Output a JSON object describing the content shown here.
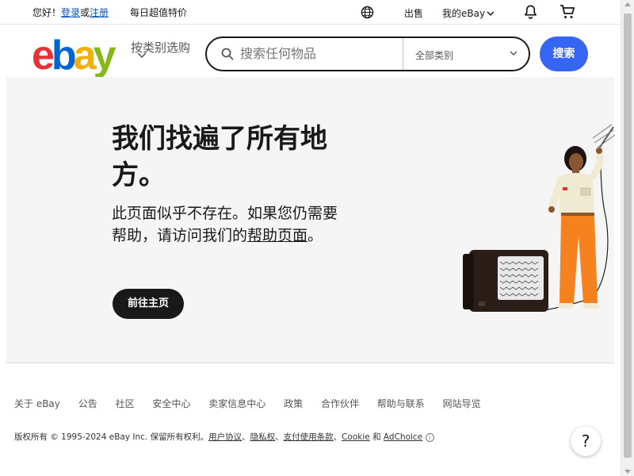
{
  "topbar": {
    "greeting": "您好！",
    "login": "登录",
    "or": "或",
    "register": "注册",
    "daily_deals": "每日超值特价",
    "sell": "出售",
    "my_ebay": "我的eBay"
  },
  "header": {
    "logo": {
      "e": "e",
      "b": "b",
      "a": "a",
      "y": "y"
    },
    "shop_by_category": "按类别选购",
    "search_placeholder": "搜索任何物品",
    "category_select": "全部类别",
    "search_button": "搜索"
  },
  "hero": {
    "title": "我们找遍了所有地方。",
    "desc_prefix": "此页面似乎不存在。如果您仍需要帮助，请访问我们的",
    "desc_link": "帮助页面",
    "desc_suffix": "。",
    "home_button": "前往主页"
  },
  "footer": {
    "links": [
      "关于 eBay",
      "公告",
      "社区",
      "安全中心",
      "卖家信息中心",
      "政策",
      "合作伙伴",
      "帮助与联系",
      "网站导览"
    ],
    "copyright_prefix": "版权所有 © 1995-2024 eBay Inc. 保留所有权利。",
    "user_agreement": "用户协议",
    "sep1": "、",
    "privacy": "隐私权",
    "sep2": "、",
    "payments_terms": "支付使用条款",
    "sep3": "、",
    "cookie": "Cookie",
    "and": " 和 ",
    "adchoice": "AdChoice",
    "info_glyph": "i"
  },
  "help_fab": "?",
  "colors": {
    "accent": "#3665f3",
    "dark": "#191919",
    "link": "#0654ba"
  }
}
